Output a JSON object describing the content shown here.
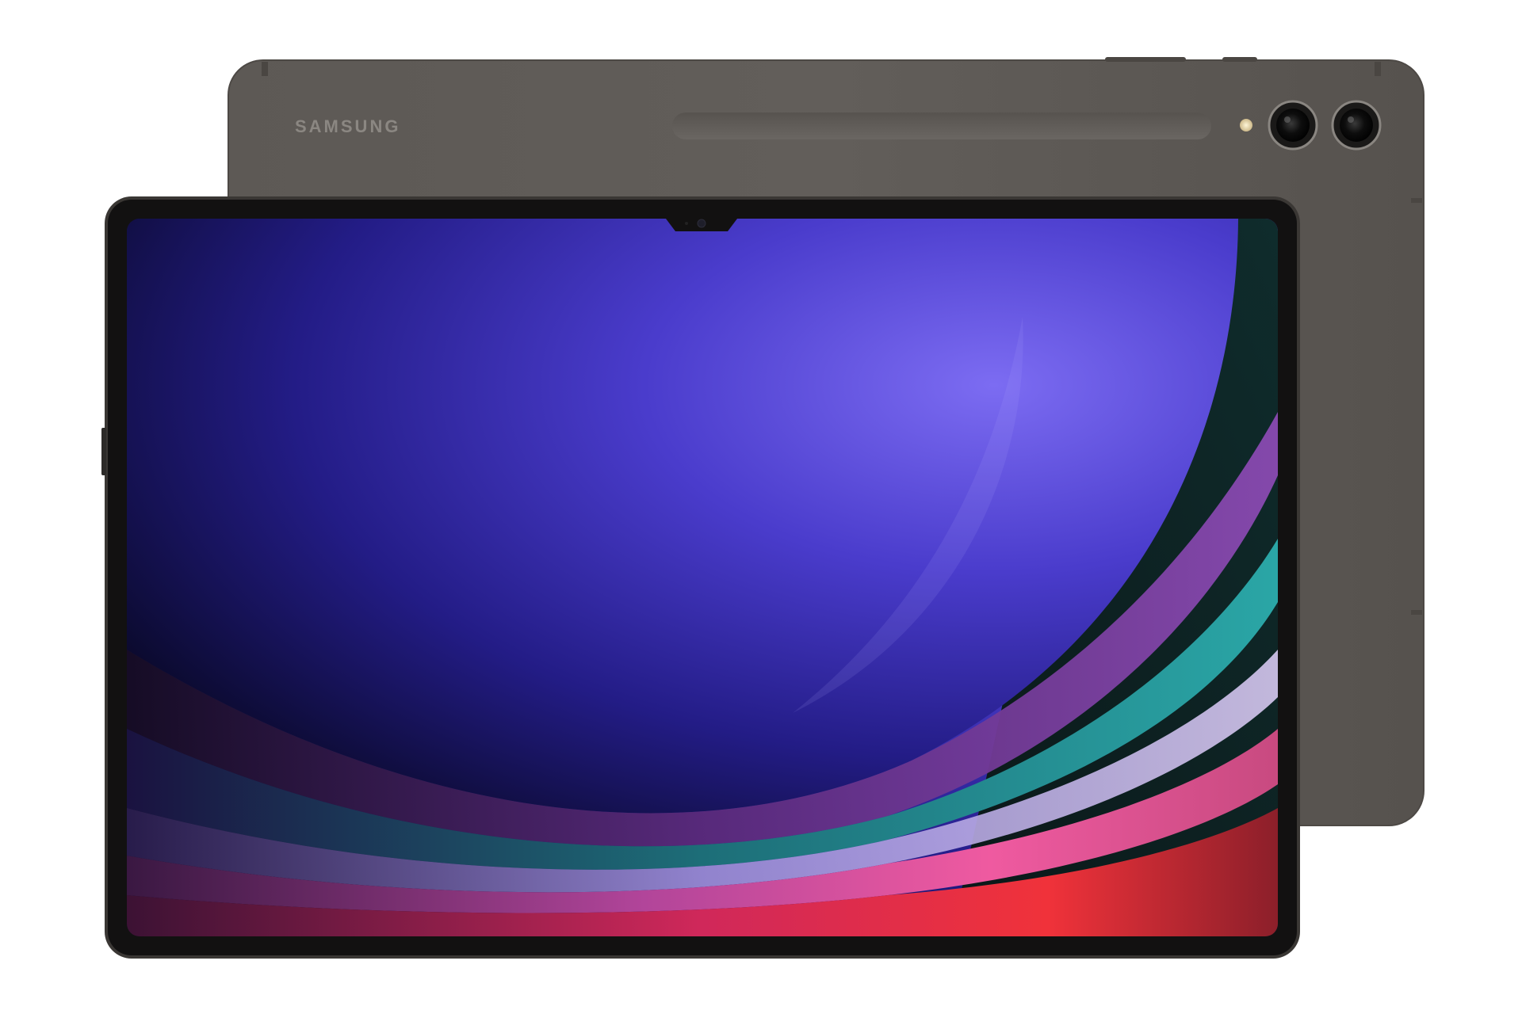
{
  "product": {
    "brand_logo_text": "SAMSUNG",
    "colors": {
      "background": "#ffffff",
      "body": "#5b5753",
      "body_edge": "#4a4642",
      "front_bezel": "#141313",
      "front_frame": "#3b3836",
      "wallpaper_deep": "#0f0c3a",
      "wallpaper_violet": "#5a4ad8",
      "wallpaper_teal": "#1f8a8c",
      "wallpaper_pink": "#e24aa0",
      "wallpaper_red": "#e6262e"
    },
    "icons": [
      "camera-lens-icon",
      "camera-lens-icon",
      "camera-flash-icon",
      "front-camera-icon"
    ]
  }
}
